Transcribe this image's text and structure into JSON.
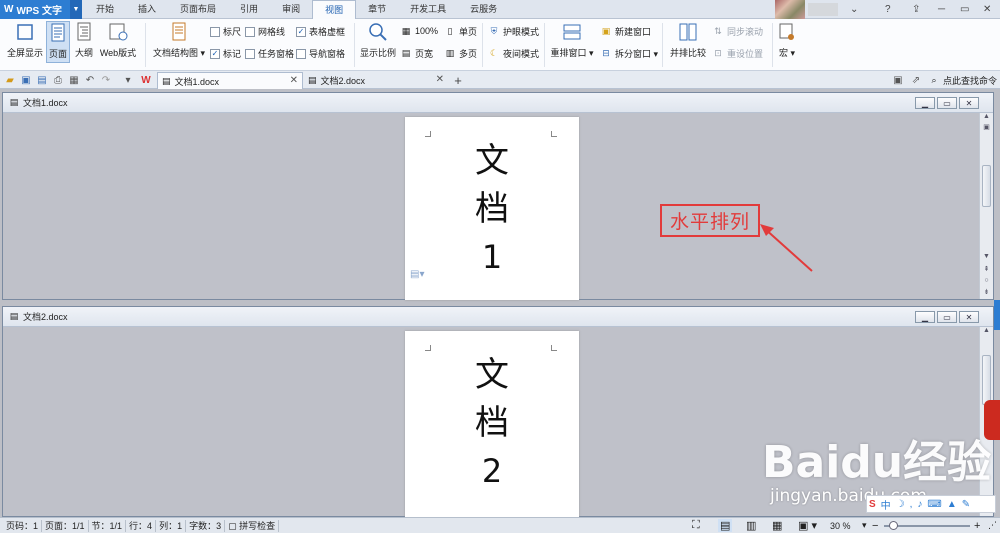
{
  "app": {
    "logo": "W",
    "name": "WPS 文字"
  },
  "menu_tabs": [
    "开始",
    "插入",
    "页面布局",
    "引用",
    "审阅",
    "视图",
    "章节",
    "开发工具",
    "云服务"
  ],
  "active_tab": "视图",
  "window_controls": {
    "help": "?",
    "minimize": "─",
    "restore": "▭",
    "close": "✕"
  },
  "ribbon": {
    "fullscreen": "全屏显示",
    "page": "页面",
    "outline": "大纲",
    "web": "Web版式",
    "doc_map": "文档结构图",
    "ruler": "标尺",
    "gridlines": "网格线",
    "table_grid": "表格虚框",
    "marks": "标记",
    "task_pane": "任务窗格",
    "nav_pane": "导航窗格",
    "zoom": "显示比例",
    "zoom_100": "100%",
    "page_width": "页宽",
    "single_page": "单页",
    "multi_page": "多页",
    "eye_mode": "护眼模式",
    "night_mode": "夜间模式",
    "rearrange": "重排窗口",
    "new_window": "新建窗口",
    "split_window": "拆分窗口",
    "side_by_side": "并排比较",
    "sync_scroll": "同步滚动",
    "reset_position": "重设位置",
    "macro": "宏"
  },
  "doc_tabs": [
    "文档1.docx",
    "文档2.docx"
  ],
  "search_cmd": "点此查找命令",
  "panes": [
    {
      "title": "文档1.docx",
      "lines": [
        "文",
        "档",
        "1"
      ]
    },
    {
      "title": "文档2.docx",
      "lines": [
        "文",
        "档",
        "2"
      ]
    }
  ],
  "annotation": "水平排列",
  "status": [
    "页码：1",
    "页面：1/1",
    "节：1/1",
    "行：4",
    "列：1",
    "字数：3",
    "拼写检查"
  ],
  "zoom_level": "30 %",
  "zoom_fraction": 0.1,
  "watermark": {
    "brand": "Baidu经验",
    "url": "jingyan.baidu.com"
  },
  "ime_label": "中"
}
